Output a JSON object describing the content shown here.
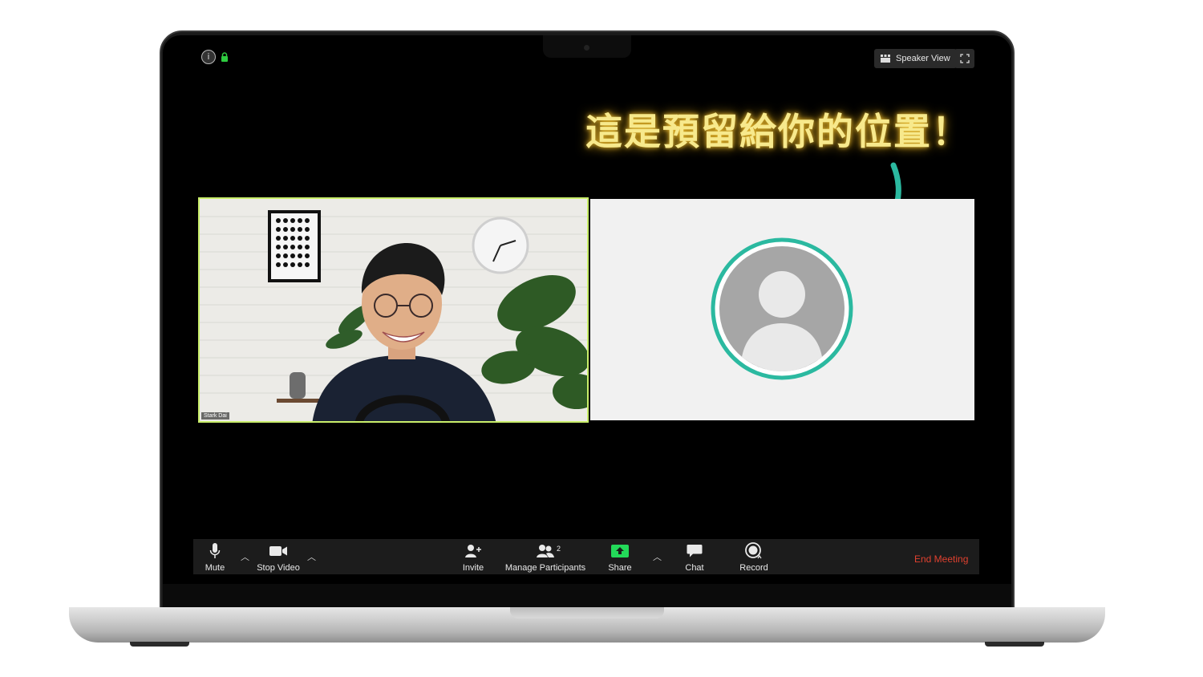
{
  "top_bar": {
    "view_label": "Speaker View"
  },
  "annotation": {
    "text": "這是預留給你的位置！"
  },
  "self_tile": {
    "name": "Stark Dai"
  },
  "toolbar": {
    "mute_label": "Mute",
    "stop_video_label": "Stop Video",
    "invite_label": "Invite",
    "manage_participants_label": "Manage Participants",
    "participant_count": "2",
    "share_label": "Share",
    "chat_label": "Chat",
    "record_label": "Record",
    "end_meeting_label": "End Meeting"
  },
  "colors": {
    "accent_green": "#c9ee6a",
    "share_green": "#23d959",
    "end_red": "#e0412f",
    "avatar_ring": "#2bb9a0",
    "annotation_yellow": "#f7e98c"
  }
}
